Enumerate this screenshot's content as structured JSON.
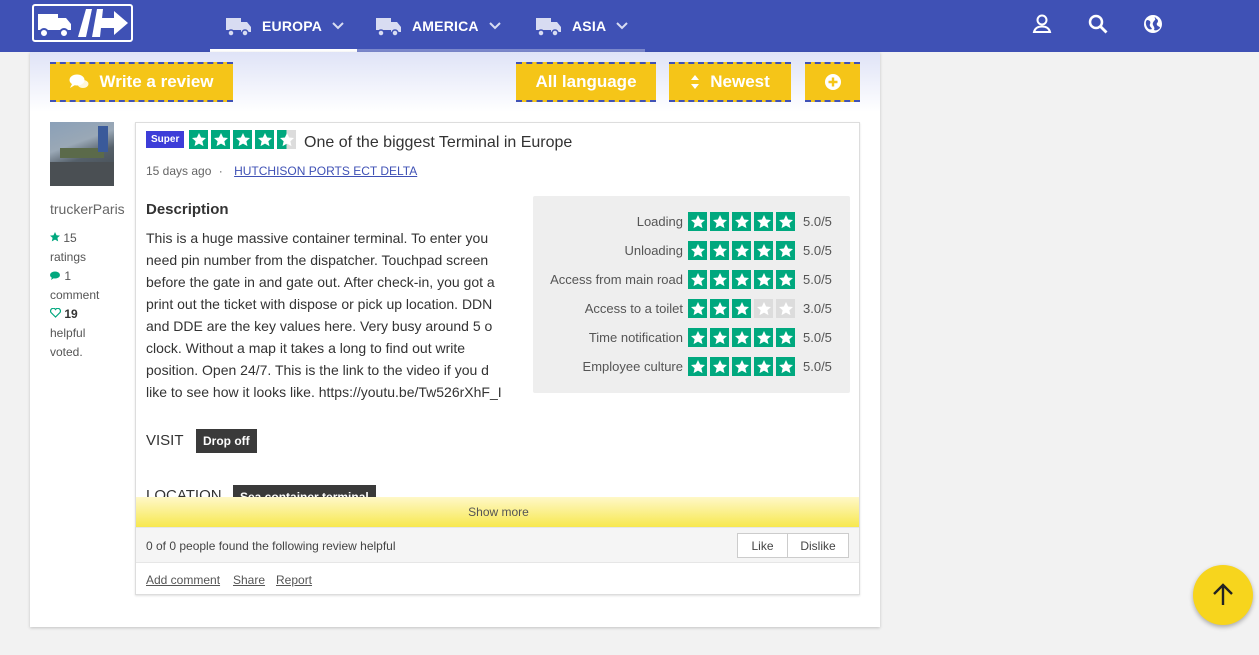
{
  "header": {
    "nav": [
      {
        "label": "EUROPA"
      },
      {
        "label": "AMERICA"
      },
      {
        "label": "ASIA"
      }
    ],
    "icons": [
      "user-icon",
      "search-icon",
      "globe-icon"
    ],
    "brand_color": "#3f51b5"
  },
  "toolbar": {
    "write_review": "Write a review",
    "language": "All language",
    "sort": "Newest"
  },
  "reviewer": {
    "name": "truckerParis",
    "ratings_count": "15",
    "ratings_label": "ratings",
    "comments_count": "1",
    "comments_label": "comment",
    "helpful_count": "19",
    "helpful_label": "helpful",
    "voted_label": "voted."
  },
  "review": {
    "badge": "Super",
    "stars": 4.5,
    "title": "One of the biggest Terminal in Europe",
    "date": "15 days ago",
    "separator": "·",
    "terminal": "HUTCHISON PORTS ECT DELTA",
    "description_heading": "Description",
    "description_lines": [
      "This is a huge massive container terminal. To enter you",
      "need pin number from the dispatcher. Touchpad screen",
      "before the gate in and gate out. After check-in, you got a",
      "print out the ticket with dispose or pick up location. DDN",
      "and DDE are the key values here. Very busy around 5 o",
      "clock. Without a map it takes a long to find out write",
      "position. Open 24/7. This is the link to the video if you d",
      "like to see how it looks like. https://youtu.be/Tw526rXhF_I"
    ],
    "ratings": [
      {
        "label": "Loading",
        "value": 5,
        "display": "5.0/5"
      },
      {
        "label": "Unloading",
        "value": 5,
        "display": "5.0/5"
      },
      {
        "label": "Access from main road",
        "value": 5,
        "display": "5.0/5"
      },
      {
        "label": "Access to a toilet",
        "value": 3,
        "display": "3.0/5"
      },
      {
        "label": "Time notification",
        "value": 5,
        "display": "5.0/5"
      },
      {
        "label": "Employee culture",
        "value": 5,
        "display": "5.0/5"
      }
    ],
    "visit_heading": "VISIT",
    "visit_tag": "Drop off",
    "location_heading": "LOCATION",
    "location_tag": "Sea container terminal",
    "show_more": "Show more",
    "helpful_text": "0 of 0 people found the following review helpful",
    "like": "Like",
    "dislike": "Dislike",
    "add_comment": "Add comment",
    "share": "Share",
    "report": "Report"
  },
  "colors": {
    "accent_yellow": "#f5c518",
    "star_green": "#00a87e",
    "super_badge": "#3d3dd8"
  }
}
